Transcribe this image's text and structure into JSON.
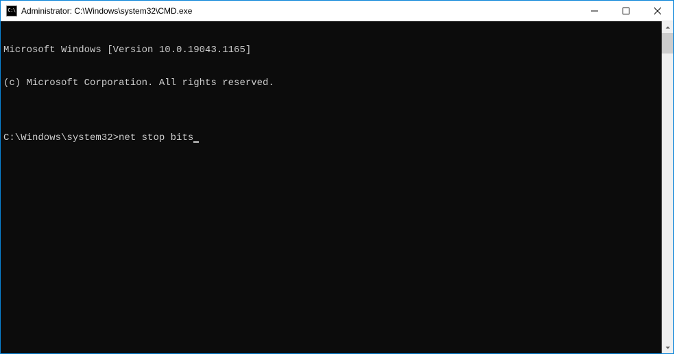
{
  "titlebar": {
    "icon_label": "C:\\",
    "title": "Administrator: C:\\Windows\\system32\\CMD.exe"
  },
  "terminal": {
    "line1": "Microsoft Windows [Version 10.0.19043.1165]",
    "line2": "(c) Microsoft Corporation. All rights reserved.",
    "blank": "",
    "prompt": "C:\\Windows\\system32>",
    "command": "net stop bits"
  }
}
